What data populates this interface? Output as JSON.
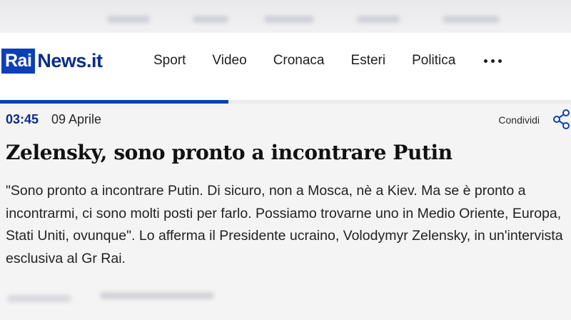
{
  "brand": {
    "logo_rai": "Rai",
    "logo_news": "News.it"
  },
  "nav": {
    "items": [
      {
        "label": "Sport"
      },
      {
        "label": "Video"
      },
      {
        "label": "Cronaca"
      },
      {
        "label": "Esteri"
      },
      {
        "label": "Politica"
      }
    ],
    "more_icon": "more-horizontal-icon"
  },
  "reading_progress": 0.4,
  "article": {
    "time": "03:45",
    "date": "09 Aprile",
    "share_label": "Condividi",
    "share_icon": "share-icon",
    "title": "Zelensky, sono pronto a incontrare Putin",
    "body": "\"Sono pronto a incontrare Putin. Di sicuro, non a Mosca, nè a Kiev. Ma se è pronto a incontrarmi, ci sono molti posti per farlo. Possiamo trovarne uno in Medio Oriente, Europa, Stati Uniti, ovunque\". Lo afferma il Presidente ucraino, Volodymyr Zelensky, in un'intervista esclusiva al Gr Rai."
  },
  "colors": {
    "brand_blue": "#0b40b5",
    "brand_dark": "#0b2d8a",
    "background": "#f4f4f4"
  }
}
